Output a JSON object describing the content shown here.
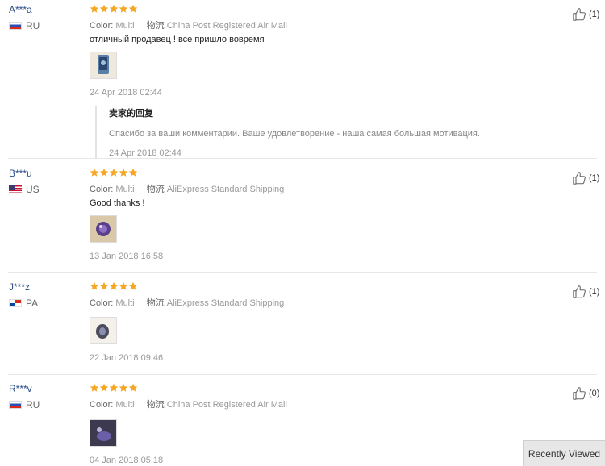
{
  "color_label": "Color:",
  "logistics_label": "物流",
  "star_color": "#f5a623",
  "reviews": [
    {
      "user": "A***a",
      "country": "RU",
      "flag": "russia",
      "rating": 5,
      "color_value": "Multi",
      "shipping": "China Post Registered Air Mail",
      "comment": "отличный продавец ! все пришло вовремя",
      "date": "24 Apr 2018 02:44",
      "likes": "(1)",
      "reply": {
        "title": "卖家的回复",
        "text": "Спасибо за ваши комментарии. Ваше удовлетворение - наша самая большая мотивация.",
        "date": "24 Apr 2018 02:44"
      }
    },
    {
      "user": "B***u",
      "country": "US",
      "flag": "usa",
      "rating": 5,
      "color_value": "Multi",
      "shipping": "AliExpress Standard Shipping",
      "comment": "Good thanks !",
      "date": "13 Jan 2018 16:58",
      "likes": "(1)"
    },
    {
      "user": "J***z",
      "country": "PA",
      "flag": "panama",
      "rating": 5,
      "color_value": "Multi",
      "shipping": "AliExpress Standard Shipping",
      "comment": "",
      "date": "22 Jan 2018 09:46",
      "likes": "(1)"
    },
    {
      "user": "R***v",
      "country": "RU",
      "flag": "russia",
      "rating": 5,
      "color_value": "Multi",
      "shipping": "China Post Registered Air Mail",
      "comment": "",
      "date": "04 Jan 2018 05:18",
      "likes": "(0)"
    }
  ],
  "recently_viewed": "Recently Viewed"
}
